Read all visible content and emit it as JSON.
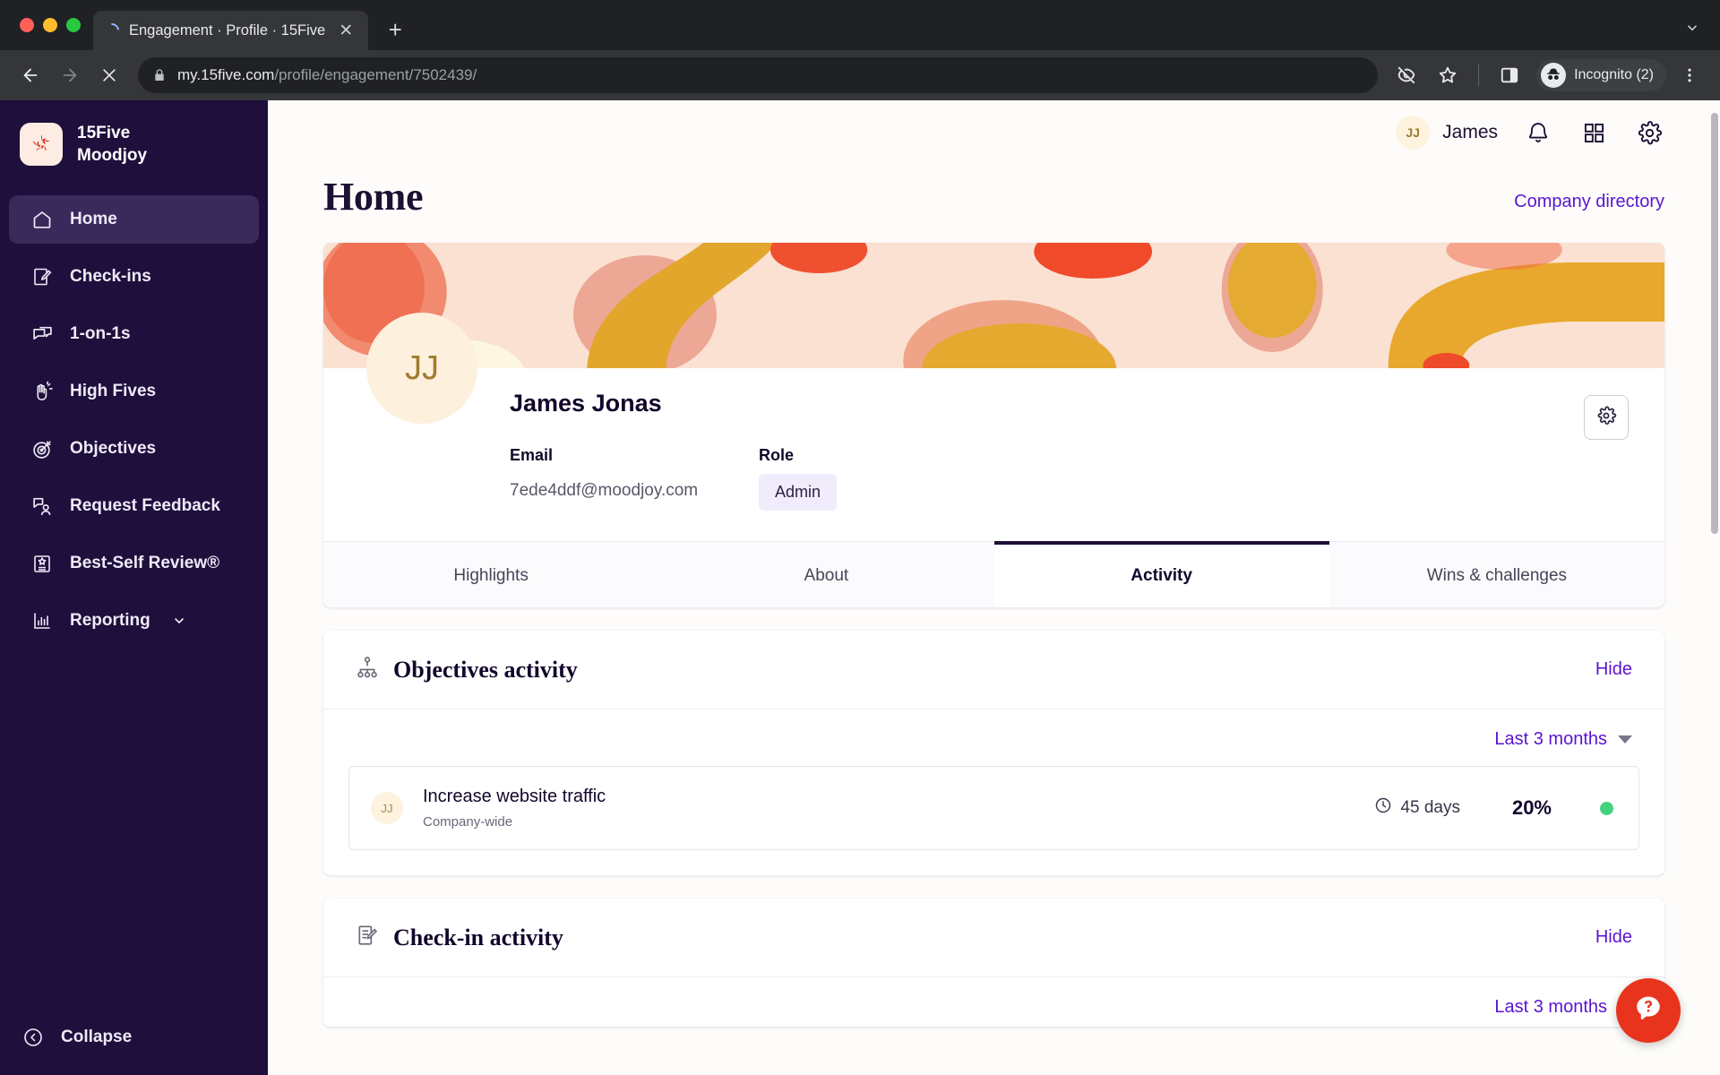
{
  "browser": {
    "tab_title": "Engagement · Profile · 15Five",
    "tab_close_label": "✕",
    "new_tab_label": "+",
    "url_domain": "my.15five.com",
    "url_path": "/profile/engagement/7502439/",
    "profile_label": "Incognito (2)",
    "icons": {
      "back": "back-arrow-icon",
      "forward": "forward-arrow-icon",
      "stop": "stop-loading-icon",
      "lock": "lock-icon",
      "tracking": "eye-off-icon",
      "bookmark": "star-icon",
      "sidepanel": "side-panel-icon",
      "incognito": "incognito-icon",
      "menu": "three-dot-menu-icon"
    }
  },
  "sidebar": {
    "brand_line1": "15Five",
    "brand_line2": "Moodjoy",
    "items": [
      {
        "label": "Home",
        "icon": "home-icon",
        "active": true
      },
      {
        "label": "Check-ins",
        "icon": "check-ins-icon",
        "active": false
      },
      {
        "label": "1-on-1s",
        "icon": "one-on-ones-icon",
        "active": false
      },
      {
        "label": "High Fives",
        "icon": "high-five-icon",
        "active": false
      },
      {
        "label": "Objectives",
        "icon": "target-icon",
        "active": false
      },
      {
        "label": "Request Feedback",
        "icon": "request-feedback-icon",
        "active": false
      },
      {
        "label": "Best-Self Review®",
        "icon": "best-self-review-icon",
        "active": false
      },
      {
        "label": "Reporting",
        "icon": "bar-chart-icon",
        "active": false,
        "chevron": true
      }
    ],
    "collapse_label": "Collapse"
  },
  "topbar": {
    "user_initials": "JJ",
    "user_name": "James",
    "icons": [
      "bell-icon",
      "apps-grid-icon",
      "gear-icon"
    ]
  },
  "header": {
    "title": "Home",
    "directory_link": "Company directory"
  },
  "profile": {
    "initials": "JJ",
    "name": "James Jonas",
    "email_label": "Email",
    "email_value": "7ede4ddf@moodjoy.com",
    "role_label": "Role",
    "role_value": "Admin",
    "settings_icon": "gear-icon"
  },
  "tabs": [
    {
      "label": "Highlights",
      "selected": false
    },
    {
      "label": "About",
      "selected": false
    },
    {
      "label": "Activity",
      "selected": true
    },
    {
      "label": "Wins & challenges",
      "selected": false
    }
  ],
  "objectives_section": {
    "title": "Objectives activity",
    "icon": "org-tree-icon",
    "hide_label": "Hide",
    "filter_label": "Last 3 months",
    "rows": [
      {
        "avatar_initials": "JJ",
        "name": "Increase website traffic",
        "scope": "Company-wide",
        "days": "45 days",
        "days_icon": "clock-icon",
        "progress": "20%",
        "status_color": "#45d27f"
      }
    ]
  },
  "checkin_section": {
    "title": "Check-in activity",
    "icon": "checkin-doc-icon",
    "hide_label": "Hide",
    "filter_label": "Last 3 months"
  },
  "help": {
    "icon": "question-chat-icon",
    "color": "#e8331d"
  },
  "colors": {
    "sidebar_bg": "#1e0f3c",
    "accent_purple": "#5a14d0",
    "brand_red": "#e8331d",
    "status_green": "#45d27f"
  }
}
